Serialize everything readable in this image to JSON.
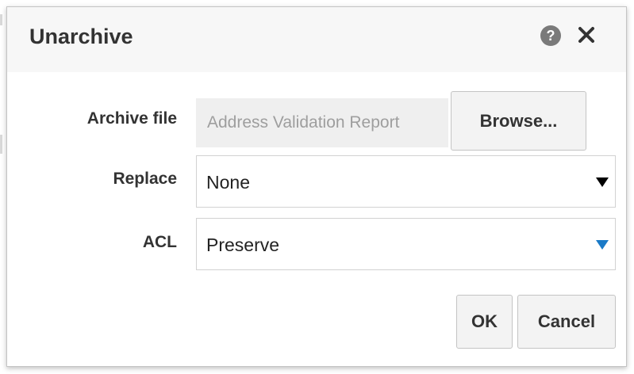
{
  "dialog": {
    "title": "Unarchive",
    "help_icon_glyph": "?",
    "help_icon": "help-circle-icon",
    "close_icon": "close-icon"
  },
  "form": {
    "archive_file": {
      "label": "Archive file",
      "value": "Address Validation Report",
      "browse_label": "Browse..."
    },
    "replace": {
      "label": "Replace",
      "value": "None"
    },
    "acl": {
      "label": "ACL",
      "value": "Preserve"
    }
  },
  "buttons": {
    "ok": "OK",
    "cancel": "Cancel"
  },
  "colors": {
    "header_bg": "#f7f7f7",
    "accent_arrow": "#1a7ac7",
    "dark_arrow": "#000000"
  }
}
